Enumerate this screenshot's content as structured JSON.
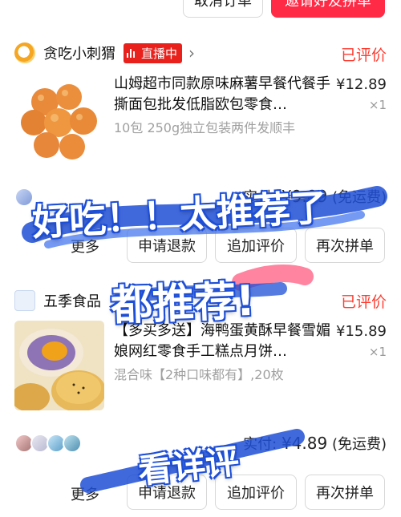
{
  "top_actions": {
    "cancel_order": "取消订单",
    "invite_group": "邀请好友拼单"
  },
  "orders": [
    {
      "shop_name": "贪吃小刺猬",
      "live_badge": "直播中",
      "status": "已评价",
      "title": "山姆超市同款原味麻薯早餐代餐手撕面包批发低脂欧包零食…",
      "spec": "10包 250g独立包装两件发顺丰",
      "price": "¥12.89",
      "qty": "×1",
      "paid_label": "实付:",
      "paid_amount": "¥9.89",
      "paid_note": "(免运费)",
      "actions": {
        "more": "更多",
        "refund": "申请退款",
        "add_review": "追加评价",
        "reorder": "再次拼单"
      }
    },
    {
      "shop_name": "五季食品",
      "status": "已评价",
      "title": "【多买多送】海鸭蛋黄酥早餐雪媚娘网红零食手工糕点月饼…",
      "spec": "混合味【2种口味都有】,20枚",
      "price": "¥15.89",
      "qty": "×1",
      "paid_label": "实付:",
      "paid_amount": "¥4.89",
      "paid_note": "(免运费)",
      "actions": {
        "more": "更多",
        "refund": "申请退款",
        "add_review": "追加评价",
        "reorder": "再次拼单"
      }
    }
  ],
  "overlay_text": {
    "line1": "好吃！！太推荐了",
    "line2": "都推荐!",
    "line3": "看详评"
  },
  "colors": {
    "accent_red": "#ff2a45",
    "status_red": "#ff3b2f",
    "overlay_blue": "#1e4fd6",
    "overlay_pink": "#ff6f8f"
  },
  "icons": [
    "shop-logo-icon",
    "live-bars-icon",
    "chevron-right-icon",
    "avatar-icon"
  ]
}
